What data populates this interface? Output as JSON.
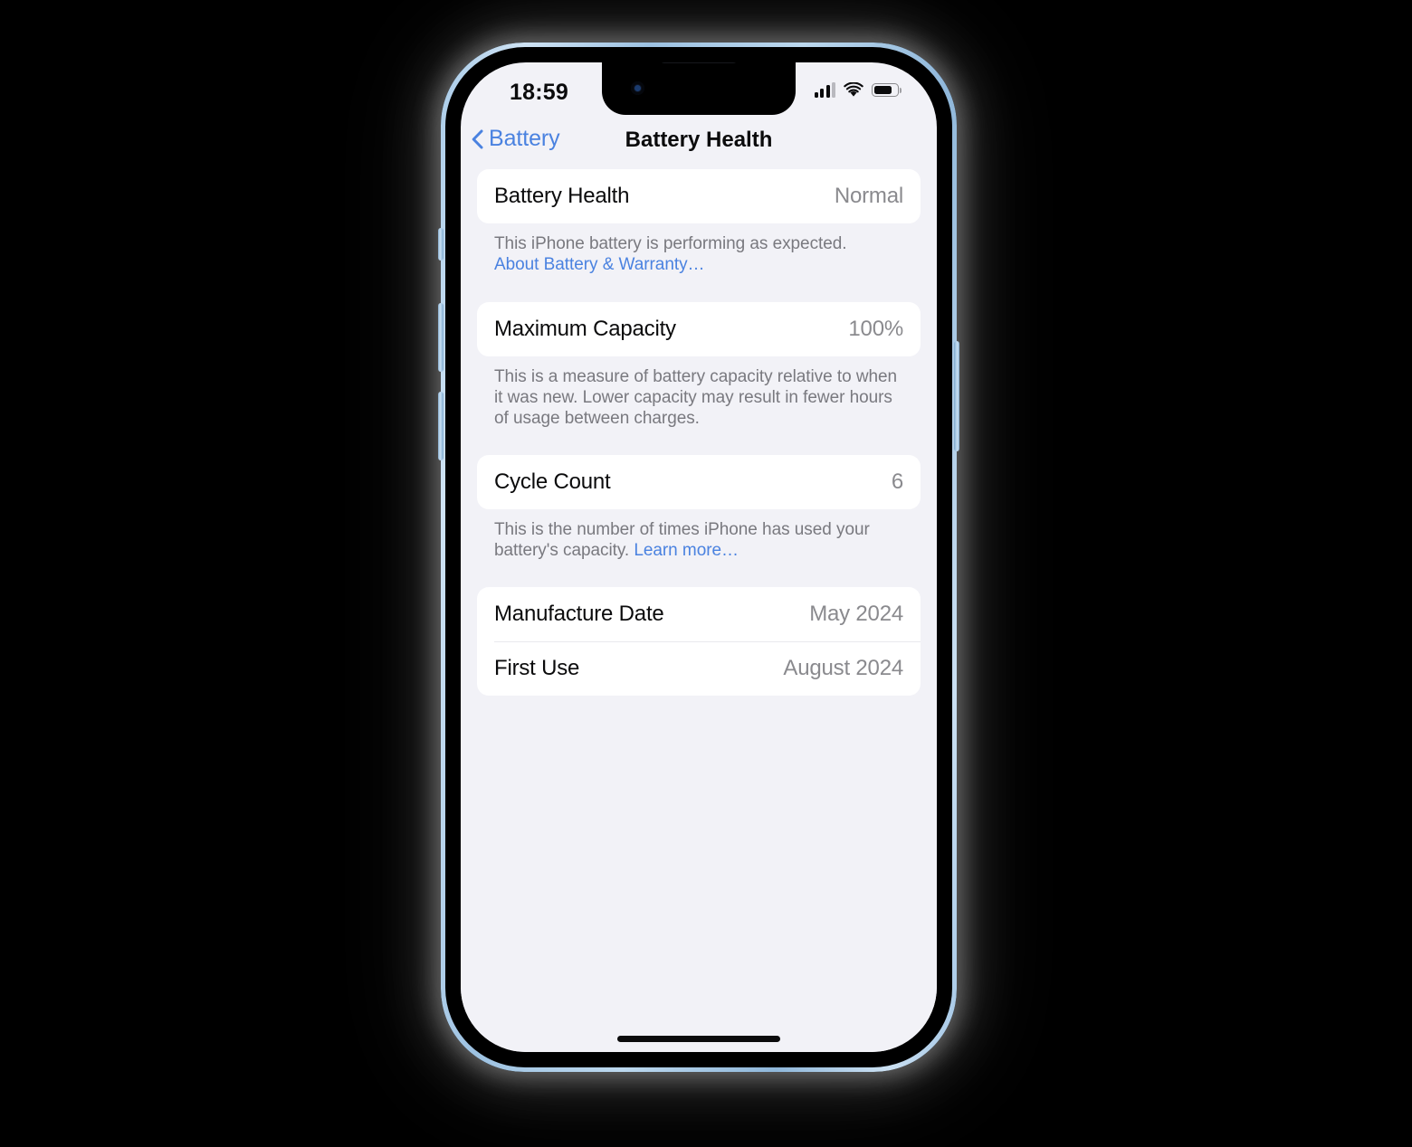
{
  "device": {
    "frame_color": "#a9cbe8",
    "bezel_color": "#000000",
    "background": "#000000",
    "buttons": [
      "silent-switch",
      "volume-up",
      "volume-down",
      "power"
    ]
  },
  "status_bar": {
    "time": "18:59",
    "cellular_bars_filled": 3,
    "cellular_bars_total": 4,
    "wifi_icon": "wifi-icon",
    "wifi_strength": "full",
    "battery_icon": "battery-icon",
    "battery_level_percent": 80
  },
  "nav": {
    "back_icon": "chevron-left-icon",
    "back_label": "Battery",
    "title": "Battery Health"
  },
  "accent_color": "#4a82e0",
  "sections": [
    {
      "rows": [
        {
          "label": "Battery Health",
          "value": "Normal"
        }
      ],
      "footnote_text": "This iPhone battery is performing as expected. ",
      "footnote_link": "About Battery & Warranty…",
      "footnote_link_on_new_line": true
    },
    {
      "rows": [
        {
          "label": "Maximum Capacity",
          "value": "100%"
        }
      ],
      "footnote_text": "This is a measure of battery capacity relative to when it was new. Lower capacity may result in fewer hours of usage between charges.",
      "footnote_link": "",
      "footnote_link_on_new_line": false
    },
    {
      "rows": [
        {
          "label": "Cycle Count",
          "value": "6"
        }
      ],
      "footnote_text": "This is the number of times iPhone has used your battery's capacity. ",
      "footnote_link": "Learn more…",
      "footnote_link_on_new_line": false
    },
    {
      "rows": [
        {
          "label": "Manufacture Date",
          "value": "May 2024"
        },
        {
          "label": "First Use",
          "value": "August 2024"
        }
      ],
      "footnote_text": "",
      "footnote_link": "",
      "footnote_link_on_new_line": false
    }
  ],
  "home_indicator": "home-indicator"
}
